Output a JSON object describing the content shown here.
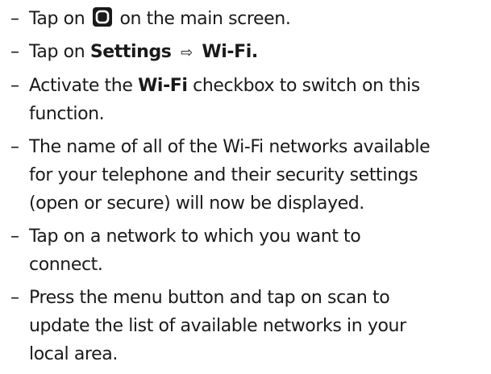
{
  "bullet": "–",
  "icons": {
    "home_button": "home-button-icon",
    "arrow": "⇨"
  },
  "steps": [
    {
      "prefix": "Tap on",
      "suffix": "on the main screen."
    },
    {
      "prefix": "Tap on",
      "bold1": "Settings",
      "bold2": "Wi-Fi."
    },
    {
      "prefix": "Activate the",
      "bold": "Wi-Fi",
      "suffix": "checkbox to switch on this",
      "line2": "function."
    },
    {
      "line1": "The name of all of the Wi-Fi networks available",
      "line2": "for your telephone and their security settings",
      "line3": "(open or secure) will now be displayed."
    },
    {
      "line1": "Tap on a network to which you want to",
      "line2": "connect."
    },
    {
      "line1": "Press the menu button and tap on scan to",
      "line2": "update the list of available networks in your",
      "line3": "local area."
    }
  ]
}
